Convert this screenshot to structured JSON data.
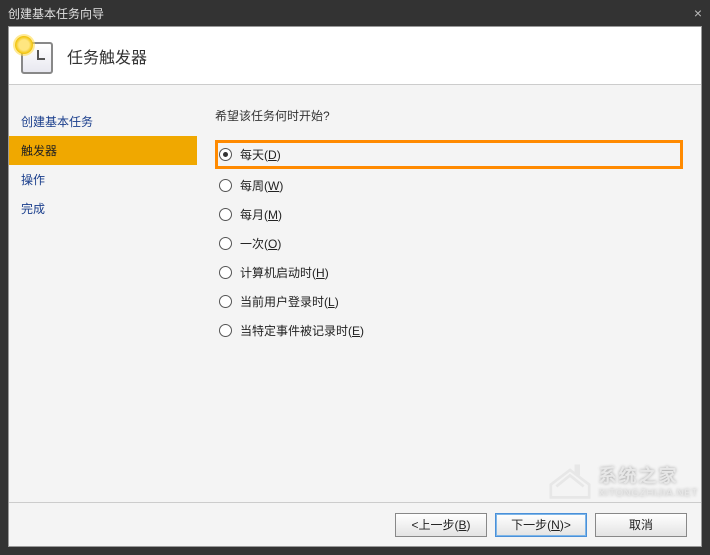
{
  "window": {
    "title": "创建基本任务向导"
  },
  "header": {
    "title": "任务触发器"
  },
  "sidebar": {
    "items": [
      {
        "label": "创建基本任务",
        "active": false
      },
      {
        "label": "触发器",
        "active": true
      },
      {
        "label": "操作",
        "active": false
      },
      {
        "label": "完成",
        "active": false
      }
    ]
  },
  "main": {
    "prompt": "希望该任务何时开始?",
    "options": [
      {
        "label": "每天",
        "key": "D",
        "selected": true
      },
      {
        "label": "每周",
        "key": "W",
        "selected": false
      },
      {
        "label": "每月",
        "key": "M",
        "selected": false
      },
      {
        "label": "一次",
        "key": "O",
        "selected": false
      },
      {
        "label": "计算机启动时",
        "key": "H",
        "selected": false
      },
      {
        "label": "当前用户登录时",
        "key": "L",
        "selected": false
      },
      {
        "label": "当特定事件被记录时",
        "key": "E",
        "selected": false
      }
    ]
  },
  "footer": {
    "back": "<上一步",
    "back_key": "B",
    "next": "下一步",
    "next_key": "N",
    "cancel": "取消"
  },
  "watermark": {
    "text1": "系统之家",
    "text2": "XITONGZHIJIA.NET"
  }
}
